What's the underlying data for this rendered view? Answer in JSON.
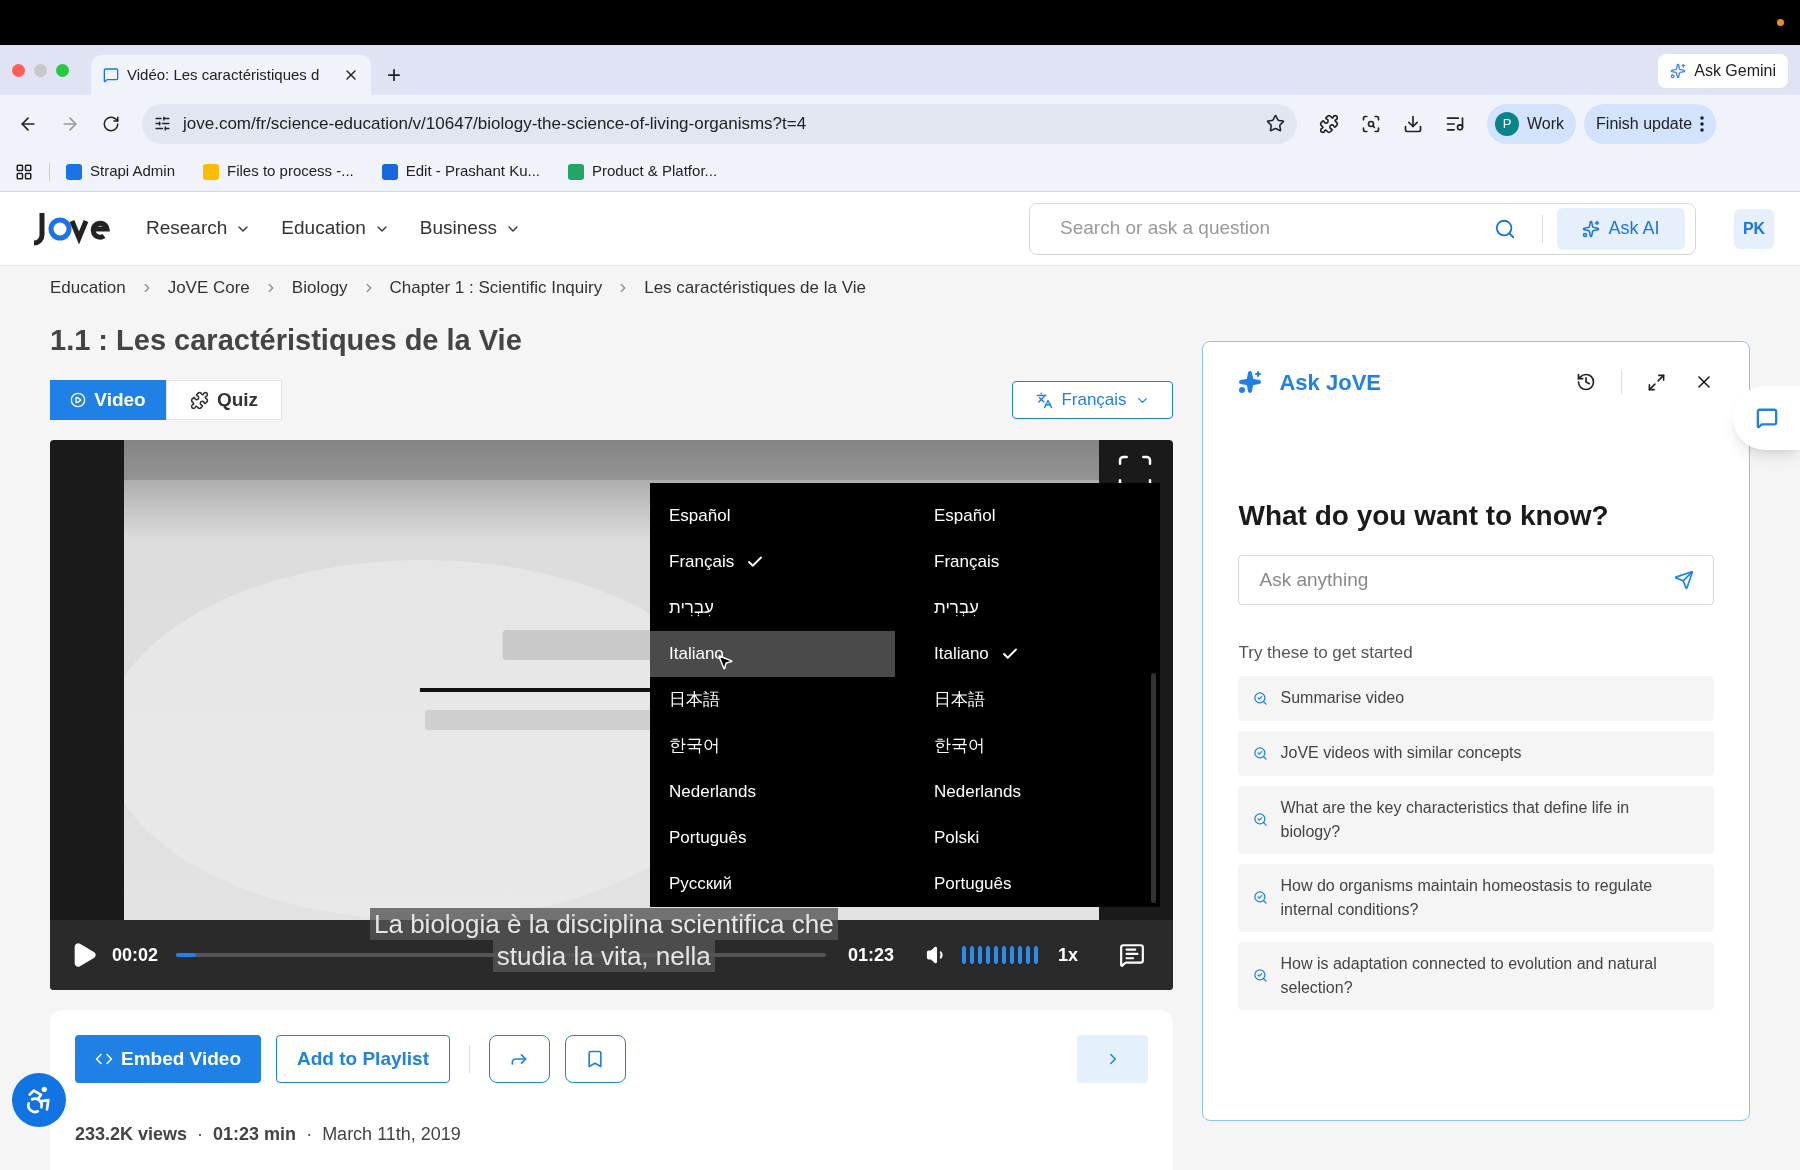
{
  "browser": {
    "tab_title": "Vidéo: Les caractéristiques d",
    "new_tab": "+",
    "ask_gemini": "Ask Gemini",
    "url": "jove.com/fr/science-education/v/10647/biology-the-science-of-living-organisms?t=4",
    "profile": {
      "initial": "P",
      "label": "Work"
    },
    "finish_update": "Finish update",
    "bookmarks": [
      {
        "label": "Strapi Admin",
        "color": "#1a73e8"
      },
      {
        "label": "Files to process -...",
        "color": "#fbbc04"
      },
      {
        "label": "Edit - Prashant Ku...",
        "color": "#1868db"
      },
      {
        "label": "Product & Platfor...",
        "color": "#23a566"
      }
    ]
  },
  "header": {
    "nav": [
      "Research",
      "Education",
      "Business"
    ],
    "search": {
      "placeholder": "Search or ask a question"
    },
    "ask_ai": "Ask AI",
    "avatar": "PK"
  },
  "breadcrumb": [
    "Education",
    "JoVE Core",
    "Biology",
    "Chapter 1 : Scientific Inquiry",
    "Les caractéristiques de la Vie"
  ],
  "title": "1.1 : Les caractéristiques de la Vie",
  "tabs": [
    {
      "label": "Video",
      "selected": true
    },
    {
      "label": "Quiz",
      "selected": false
    }
  ],
  "language_button": "Français",
  "player": {
    "time": "00:02",
    "duration": "01:23",
    "progress": {
      "level": 0.03
    },
    "volume": {
      "level": 1
    },
    "speed": "1x",
    "captions": [
      "La biologia è la disciplina scientifica che",
      "studia la vita, nella"
    ],
    "menu": {
      "columns": [
        {
          "items": [
            {
              "label": "Español",
              "selected": false,
              "hovered": false
            },
            {
              "label": "Français",
              "selected": true,
              "hovered": false
            },
            {
              "label": "עִבְרִית",
              "selected": false,
              "hovered": false
            },
            {
              "label": "Italiano",
              "selected": false,
              "hovered": true
            },
            {
              "label": "日本語",
              "selected": false,
              "hovered": false
            },
            {
              "label": "한국어",
              "selected": false,
              "hovered": false
            },
            {
              "label": "Nederlands",
              "selected": false,
              "hovered": false
            },
            {
              "label": "Português",
              "selected": false,
              "hovered": false
            },
            {
              "label": "Русский",
              "selected": false,
              "hovered": false
            }
          ]
        },
        {
          "items": [
            {
              "label": "Español",
              "selected": false,
              "hovered": false
            },
            {
              "label": "Français",
              "selected": false,
              "hovered": false
            },
            {
              "label": "עִבְרִית",
              "selected": false,
              "hovered": false
            },
            {
              "label": "Italiano",
              "selected": true,
              "hovered": false
            },
            {
              "label": "日本語",
              "selected": false,
              "hovered": false
            },
            {
              "label": "한국어",
              "selected": false,
              "hovered": false
            },
            {
              "label": "Nederlands",
              "selected": false,
              "hovered": false
            },
            {
              "label": "Polski",
              "selected": false,
              "hovered": false
            },
            {
              "label": "Português",
              "selected": false,
              "hovered": false
            }
          ]
        }
      ]
    }
  },
  "actions": {
    "embed": "Embed Video",
    "playlist": "Add to Playlist"
  },
  "meta": {
    "separator": "·",
    "items": [
      {
        "text": "233.2K views",
        "bold": true
      },
      {
        "text": "01:23 min",
        "bold": true
      },
      {
        "text": "March 11th, 2019",
        "bold": false
      }
    ]
  },
  "ask_panel": {
    "title": "Ask JoVE",
    "heading": "What do you want to know?",
    "input": {
      "placeholder": "Ask anything"
    },
    "hint": "Try these to get started",
    "suggestions": [
      "Summarise video",
      "JoVE videos with similar concepts",
      "What are the key characteristics that define life in biology?",
      "How do organisms maintain homeostasis to regulate internal conditions?",
      "How is adaptation connected to evolution and natural selection?"
    ]
  }
}
